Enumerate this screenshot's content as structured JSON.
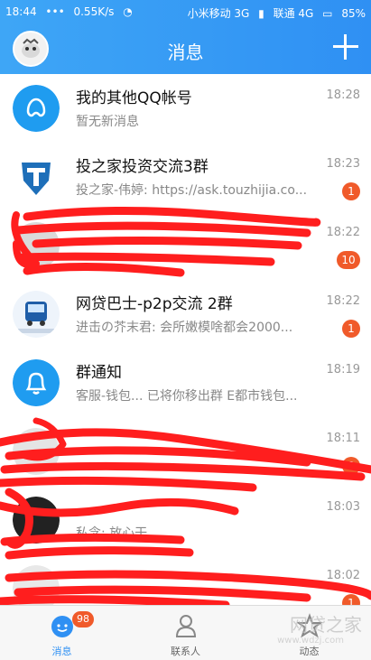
{
  "status_bar": {
    "time": "18:44",
    "speed": "0.55K/s",
    "carrier1": "小米移动 3G",
    "carrier2": "联通 4G",
    "battery": "85%"
  },
  "header": {
    "title": "消息"
  },
  "rows": [
    {
      "title": "我的其他QQ帐号",
      "preview": "暂无新消息",
      "time": "18:28",
      "badge": ""
    },
    {
      "title": "投之家投资交流3群",
      "preview": "投之家-伟婷: https://ask.touzhijia.co...",
      "time": "18:23",
      "badge": "1"
    },
    {
      "title": "",
      "preview": "",
      "time": "18:22",
      "badge": "10"
    },
    {
      "title": "网贷巴士-p2p交流 2群",
      "preview": "进击の芥末君: 会所嫩模啥都会2000...",
      "time": "18:22",
      "badge": "1"
    },
    {
      "title": "群通知",
      "preview": "客服-钱包... 已将你移出群 E都市钱包...",
      "time": "18:19",
      "badge": ""
    },
    {
      "title": "",
      "preview": "",
      "time": "18:11",
      "badge": "9"
    },
    {
      "title": "",
      "preview": "私念: 放心干",
      "time": "18:03",
      "badge": ""
    },
    {
      "title": "",
      "preview": "",
      "time": "18:02",
      "badge": "1"
    }
  ],
  "bottom_nav": {
    "messages": "消息",
    "messages_badge": "98",
    "contacts": "联系人",
    "dynamics": "动态"
  },
  "watermark": {
    "text": "网贷之家",
    "url": "www.wdzj.com"
  },
  "colors": {
    "accent": "#2f90f3",
    "badge": "#f05a2a",
    "scribble": "#ff1e1e"
  }
}
